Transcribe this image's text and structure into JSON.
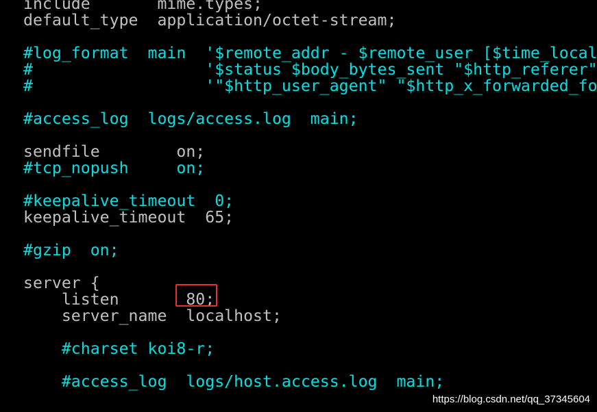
{
  "terminal": {
    "lines": [
      {
        "text": "include       mime.types;",
        "kind": "normal"
      },
      {
        "text": "default_type  application/octet-stream;",
        "kind": "normal"
      },
      {
        "text": "",
        "kind": "normal"
      },
      {
        "text": "#log_format  main  '$remote_addr - $remote_user [$time_local] \"$request\" '",
        "kind": "comment"
      },
      {
        "text": "#                  '$status $body_bytes_sent \"$http_referer\" '",
        "kind": "comment"
      },
      {
        "text": "#                  '\"$http_user_agent\" \"$http_x_forwarded_for\"';",
        "kind": "comment"
      },
      {
        "text": "",
        "kind": "normal"
      },
      {
        "text": "#access_log  logs/access.log  main;",
        "kind": "comment"
      },
      {
        "text": "",
        "kind": "normal"
      },
      {
        "text": "sendfile        on;",
        "kind": "normal"
      },
      {
        "text": "#tcp_nopush     on;",
        "kind": "comment"
      },
      {
        "text": "",
        "kind": "normal"
      },
      {
        "text": "#keepalive_timeout  0;",
        "kind": "comment"
      },
      {
        "text": "keepalive_timeout  65;",
        "kind": "normal"
      },
      {
        "text": "",
        "kind": "normal"
      },
      {
        "text": "#gzip  on;",
        "kind": "comment"
      },
      {
        "text": "",
        "kind": "normal"
      },
      {
        "text": "server {",
        "kind": "normal"
      },
      {
        "text": "    listen       80;",
        "kind": "normal"
      },
      {
        "text": "    server_name  localhost;",
        "kind": "normal"
      },
      {
        "text": "",
        "kind": "normal"
      },
      {
        "text": "    #charset koi8-r;",
        "kind": "comment"
      },
      {
        "text": "",
        "kind": "normal"
      },
      {
        "text": "    #access_log  logs/host.access.log  main;",
        "kind": "comment"
      }
    ]
  },
  "annotation": {
    "highlight_label": "80;",
    "color": "#e8312a"
  },
  "watermark": {
    "text": "https://blog.csdn.net/qq_37345604"
  },
  "colors": {
    "background": "#000000",
    "normal_text": "#c0c0c0",
    "comment_text": "#00e0e0"
  }
}
